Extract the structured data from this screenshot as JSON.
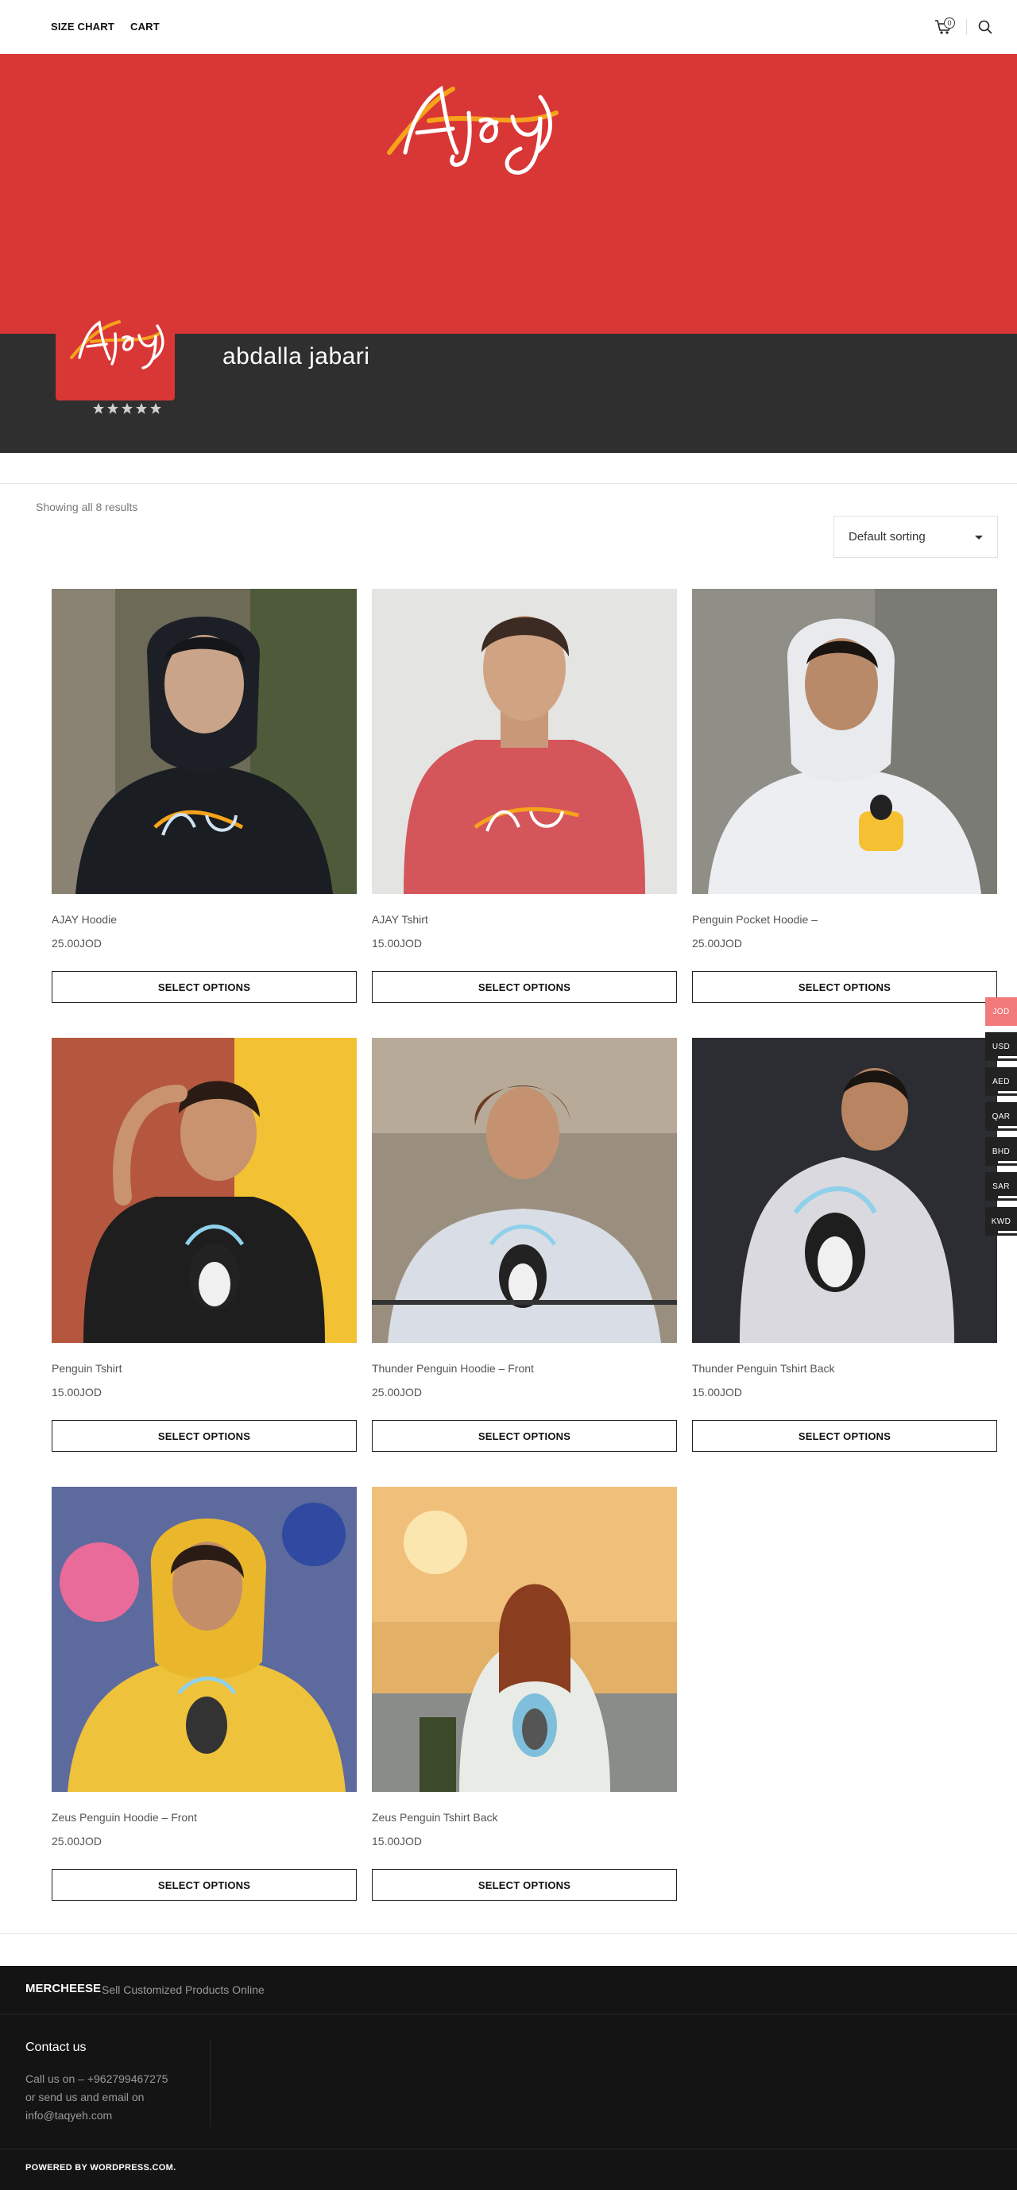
{
  "header": {
    "nav": [
      "SIZE CHART",
      "CART"
    ],
    "cart_count": "0",
    "cart_icon": "cart-icon",
    "search_icon": "search-icon"
  },
  "store": {
    "name": "abdalla jabari",
    "logo_text": "AJAY",
    "banner_color": "#d93636",
    "rating_stars": 5
  },
  "shop": {
    "results": "Showing all 8 results",
    "sort": "Default sorting"
  },
  "products": [
    {
      "title": "AJAY Hoodie",
      "price": "25.00JOD",
      "button": "SELECT OPTIONS"
    },
    {
      "title": "AJAY Tshirt",
      "price": "15.00JOD",
      "button": "SELECT OPTIONS"
    },
    {
      "title": "Penguin Pocket Hoodie –",
      "price": "25.00JOD",
      "button": "SELECT OPTIONS"
    },
    {
      "title": "Penguin Tshirt",
      "price": "15.00JOD",
      "button": "SELECT OPTIONS"
    },
    {
      "title": "Thunder Penguin Hoodie – Front",
      "price": "25.00JOD",
      "button": "SELECT OPTIONS"
    },
    {
      "title": "Thunder Penguin Tshirt Back",
      "price": "15.00JOD",
      "button": "SELECT OPTIONS"
    },
    {
      "title": "Zeus Penguin Hoodie – Front",
      "price": "25.00JOD",
      "button": "SELECT OPTIONS"
    },
    {
      "title": "Zeus Penguin Tshirt Back",
      "price": "15.00JOD",
      "button": "SELECT OPTIONS"
    }
  ],
  "currencies": [
    "JOD",
    "USD",
    "AED",
    "QAR",
    "BHD",
    "SAR",
    "KWD"
  ],
  "active_currency": "JOD",
  "footer": {
    "brand": "MERCHEESE",
    "tagline": "Sell Customized Products Online",
    "contact_title": "Contact us",
    "contact_line1": "Call us on – +962799467275",
    "contact_line2": "or send us and email on",
    "contact_line3": "info@taqyeh.com",
    "powered": "POWERED BY WORDPRESS.COM."
  }
}
